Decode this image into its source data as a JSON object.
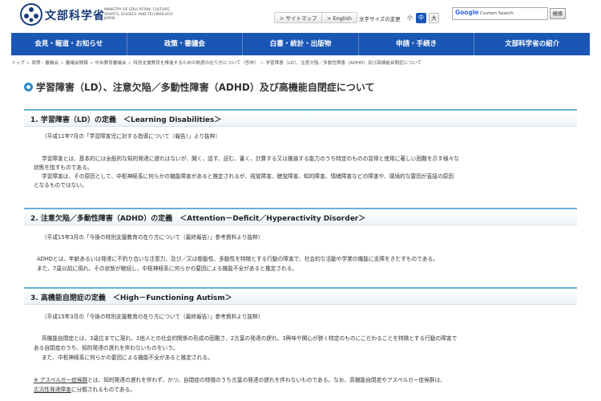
{
  "header": {
    "site_name": "文部科学省",
    "site_name_en": "MINISTRY OF EDUCATION, CULTURE, SPORTS, SCIENCE AND TECHNOLOGY-JAPAN",
    "sitemap_label": "> サイトマップ",
    "english_label": "> English",
    "font_size_label": "文字サイズの変更",
    "font_small": "小",
    "font_medium": "中",
    "font_large": "大",
    "search_brand": "Google",
    "search_placeholder": "Custom Search",
    "search_button": "検索",
    "brand_color": "#1a56b4"
  },
  "nav": {
    "items": [
      "会見・報道・お知らせ",
      "政策・審議会",
      "白書・統計・出版物",
      "申請・手続き",
      "文部科学省の紹介"
    ]
  },
  "breadcrumb": {
    "items": [
      "トップ",
      "政策・審議会",
      "審議会情報",
      "中央教育審議会",
      "特別支援教育を推進するための制度の在り方について（答申）",
      "学習障害（LD）、注意欠陥／多動性障害（ADHD）及び高機能自閉症について"
    ],
    "separator": ">"
  },
  "page_title": "学習障害（LD）、注意欠陥／多動性障害（ADHD）及び高機能自閉症について",
  "sections": [
    {
      "heading": "1. 学習障害（LD）の定義　＜Learning Disabilities＞",
      "source": "（平成11年7月の「学習障害児に対する指導について（報告）」より抜粋）",
      "lines": [
        "学習障害とは、基本的には全般的な知的発達に遅れはないが、聞く、話す、読む、書く、計算する又は推論する能力のうち特定のものの習得と使用に著しい困難を示す様々な",
        "状態を指すものである。",
        "学習障害は、その原因として、中枢神経系に何らかの機能障害があると推定されるが、視覚障害、聴覚障害、知的障害、情緒障害などの障害や、環境的な要因が直接の原因",
        "となるものではない。"
      ]
    },
    {
      "heading": "2. 注意欠陥／多動性障害（ADHD）の定義　＜Attention－Deficit／Hyperactivity Disorder＞",
      "source": "（平成15年3月の「今後の特別支援教育の在り方について（最終報告）」参考資料より抜粋）",
      "lines": [
        "ADHDとは、年齢あるいは発達に不釣り合いな注意力、及び／又は衝動性、多動性を特徴とする行動の障害で、社会的な活動や学業の機能に支障をきたすものである。",
        "また、7歳以前に現れ、その状態が継続し、中枢神経系に何らかの要因による機能不全があると推定される。"
      ]
    },
    {
      "heading": "3. 高機能自閉症の定義　＜High－Functioning Autism＞",
      "source": "（平成15年3月の「今後の特別支援教育の在り方について（最終報告）」参考資料より抜粋）",
      "lines": [
        "高機能自閉症とは、3歳位までに現れ、1他人との社会的関係の形成の困難さ、2言葉の発達の遅れ、3興味や関心が狭く特定のものにこだわることを特徴とする行動の障害で",
        "ある自閉症のうち、知的発達の遅れを伴わないものをいう。",
        "また、中枢神経系に何らかの要因による機能不全があると推定される。"
      ]
    }
  ],
  "note": {
    "term1": "※ アスペルガー症候群",
    "text1": "とは、知的発達の遅れを伴わず、かつ、自閉症の特徴のうち言葉の発達の遅れを伴わないものである。なお、高機能自閉症やアスペルガー症候群は、",
    "term2": "広汎性発達障害",
    "text2": "に分類されるものである。"
  }
}
